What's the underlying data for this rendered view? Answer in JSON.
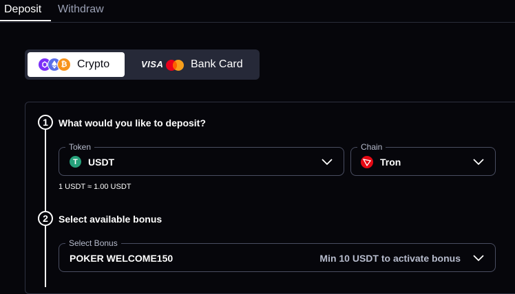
{
  "tabs": [
    {
      "label": "Deposit",
      "active": true
    },
    {
      "label": "Withdraw",
      "active": false
    }
  ],
  "payment_methods": {
    "crypto": {
      "label": "Crypto",
      "icons": [
        "polygon-coin-icon",
        "ethereum-coin-icon",
        "bitcoin-coin-icon"
      ],
      "selected": true
    },
    "bank_card": {
      "label": "Bank Card",
      "visa_text": "VISA",
      "icons": [
        "visa-logo",
        "mastercard-logo"
      ],
      "selected": false
    }
  },
  "step1": {
    "number": "1",
    "title": "What would you like to deposit?",
    "token": {
      "label": "Token",
      "value": "USDT",
      "icon": "tether-icon"
    },
    "chain": {
      "label": "Chain",
      "value": "Tron",
      "icon": "tron-icon"
    },
    "rate": "1 USDT ≈ 1.00 USDT"
  },
  "step2": {
    "number": "2",
    "title": "Select available bonus",
    "bonus": {
      "label": "Select Bonus",
      "value": "POKER WELCOME150",
      "hint": "Min 10 USDT to activate bonus"
    }
  },
  "colors": {
    "background": "#06060b",
    "toggle_bg": "#262938",
    "border": "#4a4e62",
    "muted_text": "#b7bccd",
    "tether": "#26a17b",
    "tron": "#e50914"
  }
}
